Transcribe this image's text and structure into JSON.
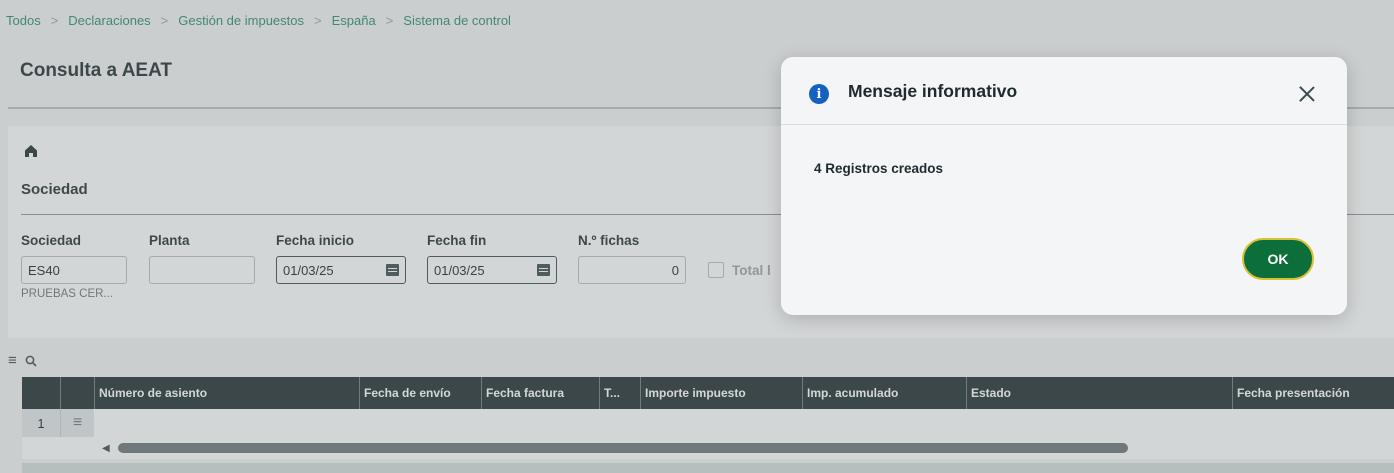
{
  "breadcrumb": [
    "Todos",
    "Declaraciones",
    "Gestión de impuestos",
    "España",
    "Sistema de control"
  ],
  "page_title": "Consulta a AEAT",
  "section": {
    "title": "Sociedad",
    "fields": {
      "sociedad": {
        "label": "Sociedad",
        "value": "ES40",
        "subtext": "PRUEBAS CER..."
      },
      "planta": {
        "label": "Planta",
        "value": ""
      },
      "fecha_inicio": {
        "label": "Fecha inicio",
        "value": "01/03/25"
      },
      "fecha_fin": {
        "label": "Fecha fin",
        "value": "01/03/25"
      },
      "n_fichas": {
        "label": "N.º fichas",
        "value": "0"
      },
      "total_label": "Total l"
    }
  },
  "grid": {
    "columns": [
      "Número de asiento",
      "Fecha de envío",
      "Fecha factura",
      "T...",
      "Importe impuesto",
      "Imp. acumulado",
      "Estado",
      "Fecha presentación"
    ],
    "rows": [
      {
        "num": "1"
      }
    ]
  },
  "icons": {
    "home": "home-icon",
    "grid_menu": "menu-icon",
    "grid_search": "search-icon",
    "calendar": "calendar-icon",
    "info": "info-icon",
    "close": "close-icon"
  },
  "modal": {
    "title": "Mensaje informativo",
    "message": "4 Registros creados",
    "ok_label": "OK",
    "info_glyph": "i"
  },
  "colors": {
    "accent_green": "#0c6e3b",
    "ok_border": "#d8c233",
    "info_blue": "#1461c2",
    "header_dark": "#1e2a2f"
  }
}
